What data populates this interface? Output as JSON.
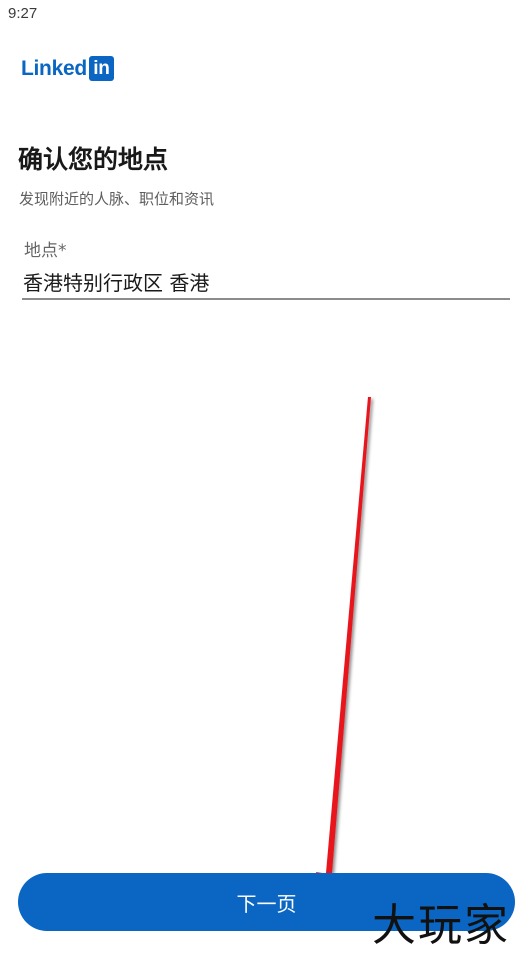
{
  "status_bar": {
    "time": "9:27"
  },
  "logo": {
    "wordmark": "Linked",
    "badge": "in"
  },
  "header": {
    "title": "确认您的地点",
    "subtitle": "发现附近的人脉、职位和资讯"
  },
  "location_field": {
    "label": "地点*",
    "value": "香港特别行政区 香港"
  },
  "next_button": {
    "label": "下一页"
  },
  "watermark": {
    "text": "大玩家"
  },
  "colors": {
    "brand": "#0a66c2",
    "arrow": "#e8141b"
  }
}
